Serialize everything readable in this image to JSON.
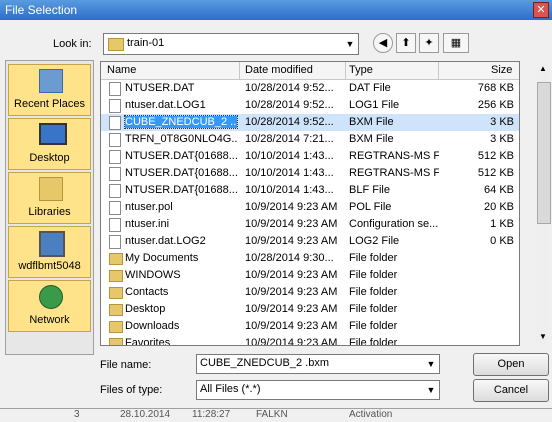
{
  "window": {
    "title": "File Selection",
    "close_glyph": "✕"
  },
  "lookin": {
    "label": "Look in:",
    "value": "train-01",
    "drop_glyph": "▼"
  },
  "toolbar": {
    "back_glyph": "◀",
    "up_glyph": "⬆",
    "newfolder_glyph": "✦",
    "views_glyph": "▦"
  },
  "places": [
    {
      "label": "Recent Places",
      "icon": "recent-places-icon"
    },
    {
      "label": "Desktop",
      "icon": "desktop-icon"
    },
    {
      "label": "Libraries",
      "icon": "libraries-icon"
    },
    {
      "label": "wdflbmt5048",
      "icon": "computer-icon"
    },
    {
      "label": "Network",
      "icon": "network-icon"
    }
  ],
  "columns": {
    "name": "Name",
    "date": "Date modified",
    "type": "Type",
    "size": "Size"
  },
  "files": [
    {
      "name": "NTUSER.DAT",
      "date": "10/28/2014 9:52...",
      "type": "DAT File",
      "size": "768 KB",
      "kind": "file"
    },
    {
      "name": "ntuser.dat.LOG1",
      "date": "10/28/2014 9:52...",
      "type": "LOG1 File",
      "size": "256 KB",
      "kind": "file"
    },
    {
      "name": "CUBE_ZNEDCUB_2 ....",
      "date": "10/28/2014 9:52...",
      "type": "BXM File",
      "size": "3 KB",
      "kind": "file",
      "selected": true
    },
    {
      "name": "TRFN_0T8G0NLO4G...",
      "date": "10/28/2014 7:21...",
      "type": "BXM File",
      "size": "3 KB",
      "kind": "file"
    },
    {
      "name": "NTUSER.DAT{01688...",
      "date": "10/10/2014 1:43...",
      "type": "REGTRANS-MS File",
      "size": "512 KB",
      "kind": "file"
    },
    {
      "name": "NTUSER.DAT{01688...",
      "date": "10/10/2014 1:43...",
      "type": "REGTRANS-MS File",
      "size": "512 KB",
      "kind": "file"
    },
    {
      "name": "NTUSER.DAT{01688...",
      "date": "10/10/2014 1:43...",
      "type": "BLF File",
      "size": "64 KB",
      "kind": "file"
    },
    {
      "name": "ntuser.pol",
      "date": "10/9/2014 9:23 AM",
      "type": "POL File",
      "size": "20 KB",
      "kind": "file"
    },
    {
      "name": "ntuser.ini",
      "date": "10/9/2014 9:23 AM",
      "type": "Configuration se...",
      "size": "1 KB",
      "kind": "file"
    },
    {
      "name": "ntuser.dat.LOG2",
      "date": "10/9/2014 9:23 AM",
      "type": "LOG2 File",
      "size": "0 KB",
      "kind": "file"
    },
    {
      "name": "My Documents",
      "date": "10/28/2014 9:30...",
      "type": "File folder",
      "size": "",
      "kind": "folder"
    },
    {
      "name": "WINDOWS",
      "date": "10/9/2014 9:23 AM",
      "type": "File folder",
      "size": "",
      "kind": "folder"
    },
    {
      "name": "Contacts",
      "date": "10/9/2014 9:23 AM",
      "type": "File folder",
      "size": "",
      "kind": "folder"
    },
    {
      "name": "Desktop",
      "date": "10/9/2014 9:23 AM",
      "type": "File folder",
      "size": "",
      "kind": "folder"
    },
    {
      "name": "Downloads",
      "date": "10/9/2014 9:23 AM",
      "type": "File folder",
      "size": "",
      "kind": "folder"
    },
    {
      "name": "Favorites",
      "date": "10/9/2014 9:23 AM",
      "type": "File folder",
      "size": "",
      "kind": "folder"
    }
  ],
  "filename": {
    "label": "File name:",
    "value": "CUBE_ZNEDCUB_2 .bxm"
  },
  "filetype": {
    "label": "Files of type:",
    "value": "All Files (*.*)"
  },
  "buttons": {
    "open": "Open",
    "cancel": "Cancel"
  },
  "scroll": {
    "up_glyph": "▲",
    "down_glyph": "▼"
  },
  "background_row": {
    "num": "3",
    "date": "28.10.2014",
    "time": "11:28:27",
    "user": "FALKN",
    "status": "Activation"
  }
}
